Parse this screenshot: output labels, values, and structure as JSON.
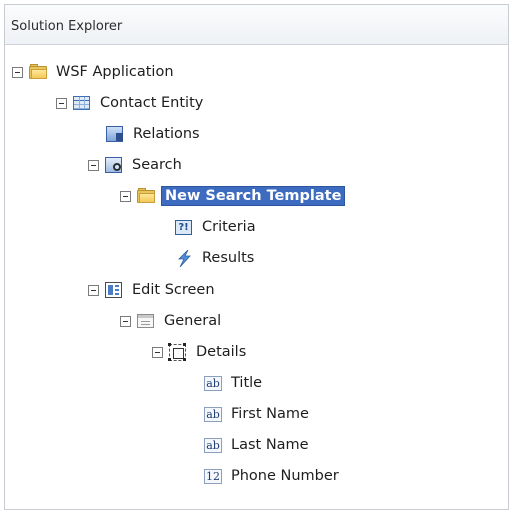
{
  "panel": {
    "title": "Solution Explorer"
  },
  "tree": {
    "wsf_application": "WSF Application",
    "contact_entity": "Contact Entity",
    "relations": "Relations",
    "search": "Search",
    "new_search_template": "New Search Template",
    "criteria": "Criteria",
    "results": "Results",
    "edit_screen": "Edit Screen",
    "general": "General",
    "details": "Details",
    "fields": [
      {
        "label": "Title",
        "type_badge": "ab"
      },
      {
        "label": "First Name",
        "type_badge": "ab"
      },
      {
        "label": "Last Name",
        "type_badge": "ab"
      },
      {
        "label": "Phone Number",
        "type_badge": "12"
      }
    ]
  },
  "icons": {
    "wsf_application": "folder-icon",
    "contact_entity": "entity-grid-icon",
    "relations": "relations-icon",
    "search": "search-icon",
    "new_search_template": "folder-icon",
    "criteria": "criteria-icon",
    "results": "lightning-icon",
    "edit_screen": "screen-layout-icon",
    "general": "form-section-icon",
    "details": "details-frame-icon"
  },
  "colors": {
    "selection": "#3d6bbf",
    "selection_text": "#ffffff",
    "folder": "#e9c65a"
  }
}
